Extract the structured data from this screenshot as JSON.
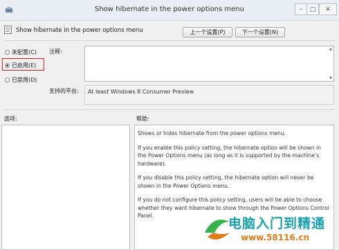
{
  "window": {
    "title": "Show hibernate in the power options menu",
    "controls": {
      "minimize": "–",
      "maximize": "□",
      "close": "✕"
    }
  },
  "header": {
    "title": "Show hibernate in the power options menu",
    "prev_button": "上一个设置(P)",
    "next_button": "下一个设置(N)"
  },
  "state": {
    "options": [
      {
        "label": "未配置(C)",
        "selected": false
      },
      {
        "label": "已启用(E)",
        "selected": true
      },
      {
        "label": "已禁用(D)",
        "selected": false
      }
    ]
  },
  "fields": {
    "comment_label": "注释:",
    "comment_value": "",
    "supported_label": "支持的平台:",
    "supported_value": "At least Windows 8 Consumer Preview"
  },
  "panes": {
    "options_label": "选项:",
    "help_label": "帮助:",
    "help_paragraphs": [
      "Shows or hides hibernate from the power options menu.",
      "If you enable this policy setting, the hibernate option will be shown in the Power Options menu (as long as it is supported by the machine's hardware).",
      "If you disable this policy setting, the hibernate option will never be shown in the Power Options menu.",
      "If you do not configure this policy setting, users will be able to choose whether they want hibernate to show through the Power Options Control Panel."
    ]
  },
  "watermark": {
    "title": "电脑入门到精通",
    "url": "www.58116.cn"
  },
  "colors": {
    "highlight_border": "#d32020",
    "watermark_title": "#1aa0b0",
    "watermark_url": "#e07a1a"
  }
}
